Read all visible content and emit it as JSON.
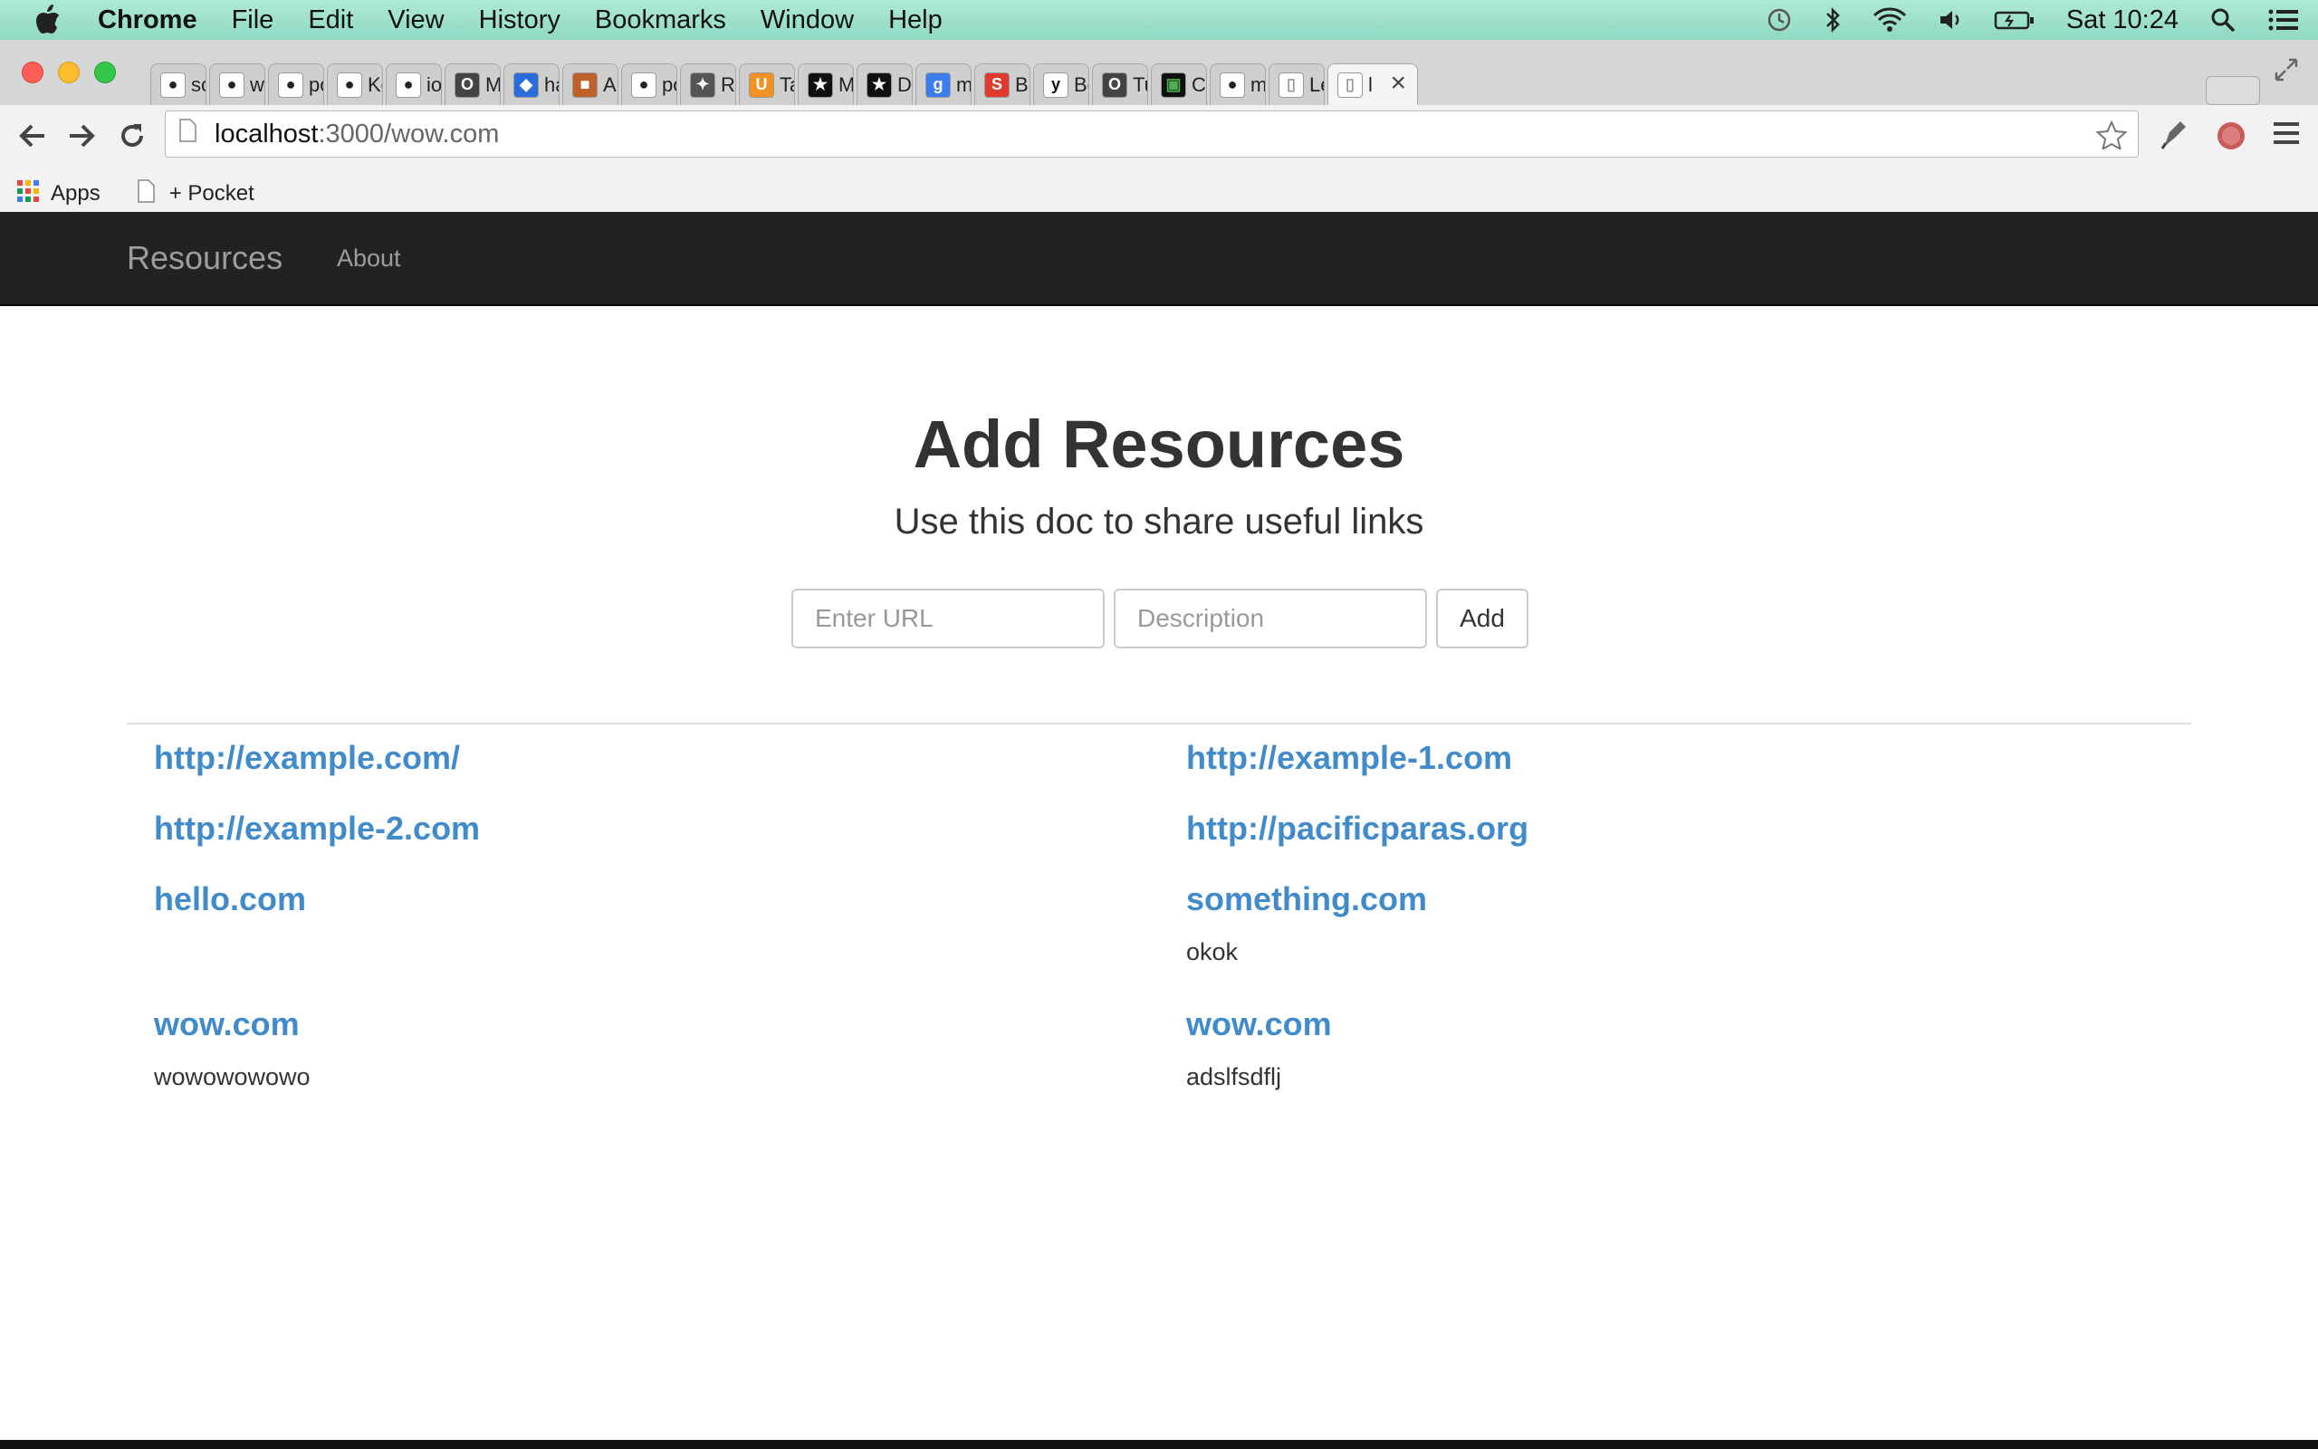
{
  "menubar": {
    "app_name": "Chrome",
    "menus": [
      "File",
      "Edit",
      "View",
      "History",
      "Bookmarks",
      "Window",
      "Help"
    ],
    "clock": "Sat 10:24"
  },
  "tabs": [
    {
      "label": "sch",
      "icon": "github-icon"
    },
    {
      "label": "wel",
      "icon": "github-icon"
    },
    {
      "label": "pos",
      "icon": "github-icon"
    },
    {
      "label": "Key",
      "icon": "github-icon"
    },
    {
      "label": "ion",
      "icon": "github-icon"
    },
    {
      "label": "My",
      "icon": "o-icon"
    },
    {
      "label": "hair",
      "icon": "shield-icon"
    },
    {
      "label": "Aru",
      "icon": "box-icon"
    },
    {
      "label": "pos",
      "icon": "github-icon"
    },
    {
      "label": "REM",
      "icon": "network-icon"
    },
    {
      "label": "Talk",
      "icon": "u-icon"
    },
    {
      "label": "Met",
      "icon": "star-icon"
    },
    {
      "label": "Doc",
      "icon": "star-icon"
    },
    {
      "label": "met",
      "icon": "google-icon"
    },
    {
      "label": "Buil",
      "icon": "s-icon"
    },
    {
      "label": "Best",
      "icon": "y-icon"
    },
    {
      "label": "Tut",
      "icon": "o-icon"
    },
    {
      "label": "Con",
      "icon": "green-icon"
    },
    {
      "label": "met",
      "icon": "github-icon"
    },
    {
      "label": "Lea",
      "icon": "page-icon"
    },
    {
      "label": "l",
      "icon": "page-icon",
      "active": true
    }
  ],
  "omnibox": {
    "host": "localhost",
    "rest": ":3000/wow.com"
  },
  "bookmarks_bar": {
    "apps": "Apps",
    "pocket": "+ Pocket"
  },
  "navbar": {
    "brand": "Resources",
    "about": "About"
  },
  "main": {
    "title": "Add Resources",
    "subtitle": "Use this doc to share useful links",
    "url_placeholder": "Enter URL",
    "desc_placeholder": "Description",
    "add_label": "Add"
  },
  "resources": [
    {
      "url": "http://example.com/",
      "desc": ""
    },
    {
      "url": "http://example-1.com",
      "desc": ""
    },
    {
      "url": "http://example-2.com",
      "desc": ""
    },
    {
      "url": "http://pacificparas.org",
      "desc": ""
    },
    {
      "url": "hello.com",
      "desc": ""
    },
    {
      "url": "something.com",
      "desc": "okok"
    },
    {
      "url": "wow.com",
      "desc": "wowowowowo"
    },
    {
      "url": "wow.com",
      "desc": "adslfsdflj"
    }
  ],
  "colors": {
    "link": "#428bca",
    "navbar": "#222222",
    "menubar": "#9fe2cd"
  }
}
